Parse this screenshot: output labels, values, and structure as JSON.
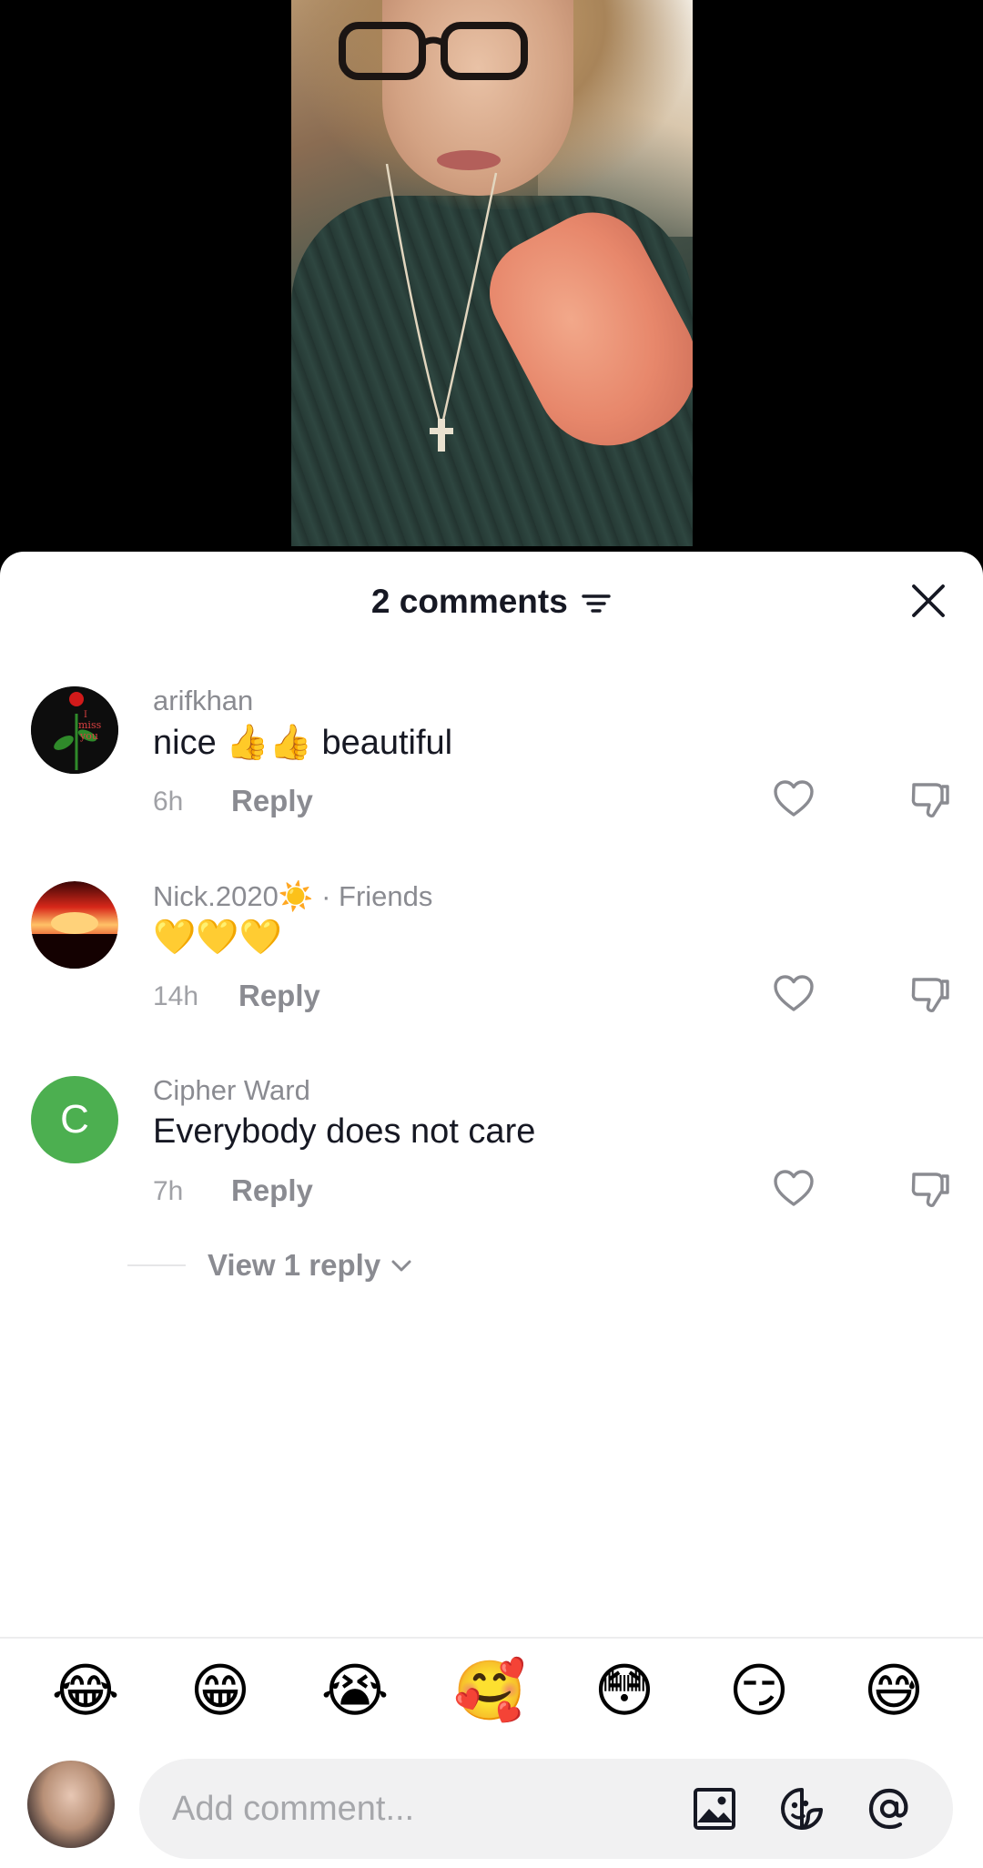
{
  "sheet": {
    "comment_count_label": "2 comments"
  },
  "comments": [
    {
      "username": "arifkhan",
      "text": "nice 👍👍 beautiful",
      "time": "6h",
      "reply_label": "Reply"
    },
    {
      "username": "Nick.2020☀️",
      "badge": "· Friends",
      "text": "💛💛💛",
      "time": "14h",
      "reply_label": "Reply"
    },
    {
      "username": "Cipher Ward",
      "avatar_initial": "C",
      "text": "Everybody does not care",
      "time": "7h",
      "reply_label": "Reply"
    }
  ],
  "view_replies_label": "View 1 reply",
  "emoji_bar": [
    "😂",
    "😁",
    "😭",
    "🥰",
    "😳",
    "😏",
    "😅"
  ],
  "composer": {
    "placeholder": "Add comment..."
  },
  "colors": {
    "primary_text": "#161823",
    "secondary_text": "#8a8b91",
    "avatar_green": "#4caf50"
  }
}
